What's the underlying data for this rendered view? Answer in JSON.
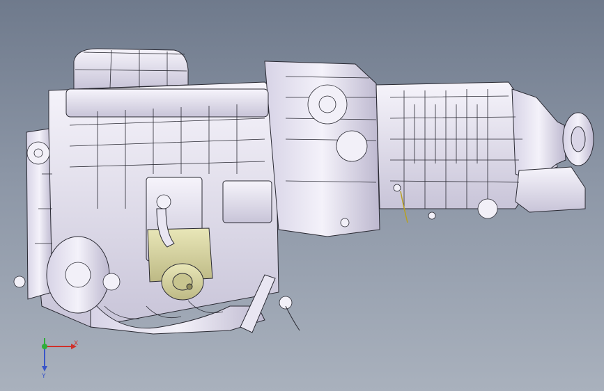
{
  "viewport": {
    "background_top": "#6f7a8c",
    "background_bottom": "#a9b1bd",
    "model_fill": "#ece9f4",
    "model_shade": "#c9c6d8",
    "edge_color": "#2a2a33",
    "highlight_part_color": "#d9d6a4"
  },
  "triad": {
    "x_label": "X",
    "y_label": "Y",
    "x_color": "#d0302a",
    "y_color": "#2fae3a",
    "z_color": "#3a55c8"
  }
}
